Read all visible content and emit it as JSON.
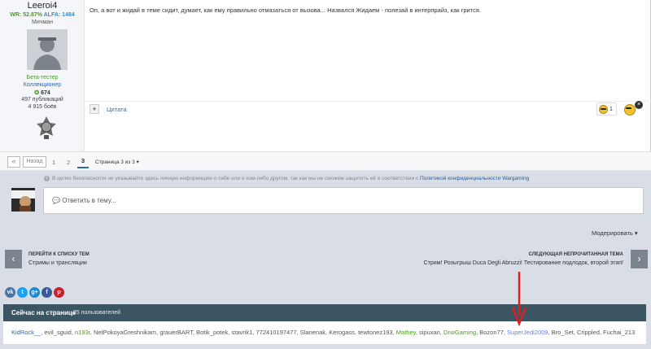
{
  "author": {
    "name": "Leeroi4",
    "wr": "WR: 52.87%",
    "alfa": "ALFA: 1484",
    "rank": "Мичман",
    "group1": "Бета-тестер",
    "group2": "Коллекционер",
    "reputation": "674",
    "posts": "497 публикаций",
    "battles": "4 915 боёв"
  },
  "post": {
    "text": "Оп, а вот и жидай в теме сидит, думает, как ему правильно отмазаться от вызова... Назвался Жидаем - полезай в интерпрайз, как гритcя.",
    "quote_label": "Цитата",
    "reaction_count": "1"
  },
  "pagination": {
    "first": "«",
    "prev": "Назад",
    "pages": [
      "1",
      "2",
      "3"
    ],
    "page_select": "Страница 3 из 3 ▾"
  },
  "privacy": {
    "text": "В целях безопасности не указывайте здесь личную информацию о себе или о ком-либо другом, так как мы не сможем защитить её в соответствии с ",
    "link": "Политикой конфиденциальности Wargaming"
  },
  "reply": {
    "placeholder": "Ответить в тему..."
  },
  "moderate": "Модерировать ▾",
  "nav": {
    "back_title": "ПЕРЕЙТИ К СПИСКУ ТЕМ",
    "back_sub": "Стримы и трансляции",
    "next_title": "СЛЕДУЮЩАЯ НЕПРОЧИТАННАЯ ТЕМА",
    "next_sub": "Стрим! Розыгрыш Duca Degli Abruzzi! Тестирование подлодок, второй этап!"
  },
  "share": [
    {
      "icon": "vk-icon",
      "glyph": "vk",
      "color": "#4c75a3"
    },
    {
      "icon": "twitter-icon",
      "glyph": "t",
      "color": "#1da1f2"
    },
    {
      "icon": "google-plus-icon",
      "glyph": "g+",
      "color": "#1a8ad2"
    },
    {
      "icon": "facebook-icon",
      "glyph": "f",
      "color": "#3b5998"
    },
    {
      "icon": "pinterest-icon",
      "glyph": "p",
      "color": "#c8232c"
    }
  ],
  "online": {
    "title": "Сейчас на странице",
    "count": "25 пользователей",
    "users": [
      {
        "name": "KidRock__",
        "style": "blue"
      },
      {
        "name": "evil_sguid",
        "style": "default"
      },
      {
        "name": "n193r",
        "style": "green"
      },
      {
        "name": "NetPokoyaGreshnikam",
        "style": "default"
      },
      {
        "name": "grauerBART",
        "style": "default"
      },
      {
        "name": "Botik_potek",
        "style": "default"
      },
      {
        "name": "stavrik1",
        "style": "default"
      },
      {
        "name": "772410197477",
        "style": "default"
      },
      {
        "name": "Slanenak",
        "style": "default"
      },
      {
        "name": "Kerogass",
        "style": "default"
      },
      {
        "name": "tewtonez193",
        "style": "default"
      },
      {
        "name": "Mathey",
        "style": "green"
      },
      {
        "name": "sipuxan",
        "style": "default"
      },
      {
        "name": "DnoGaming",
        "style": "green"
      },
      {
        "name": "Bozon77",
        "style": "default"
      },
      {
        "name": "SuperJedi2009",
        "style": "violet"
      },
      {
        "name": "Bro_Set",
        "style": "default"
      },
      {
        "name": "Crippled",
        "style": "default"
      },
      {
        "name": "Fuchai_213",
        "style": "default"
      }
    ]
  }
}
